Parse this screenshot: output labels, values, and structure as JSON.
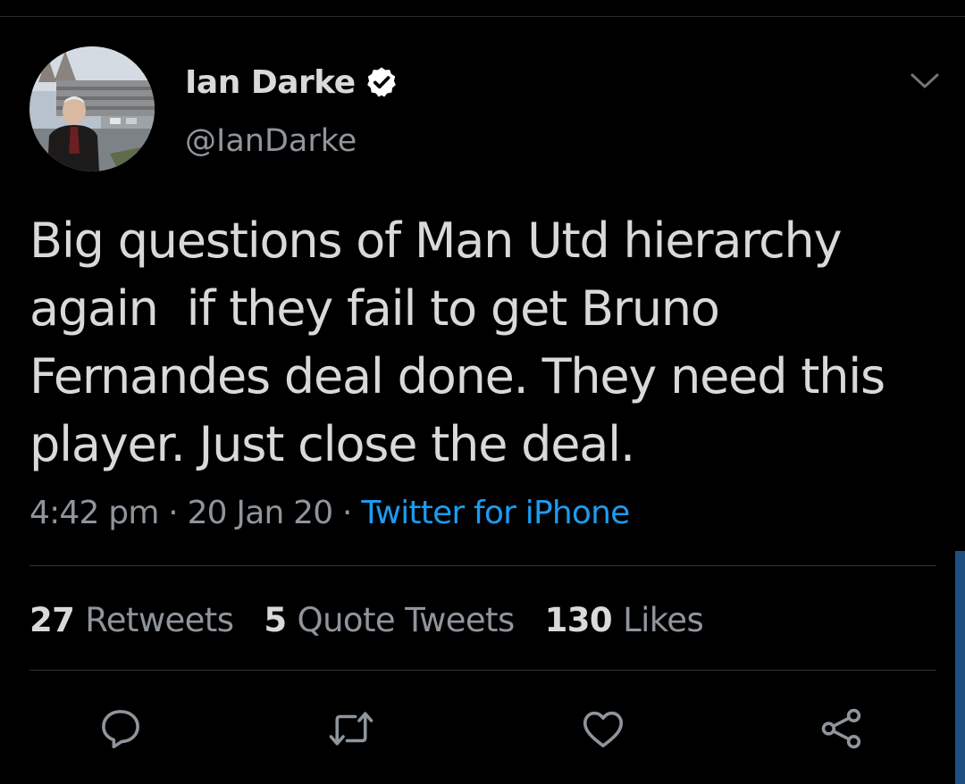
{
  "tweet": {
    "author": {
      "display_name": "Ian Darke",
      "handle": "@IanDarke",
      "verified": true,
      "avatar_icon": "profile-photo"
    },
    "text": "Big questions of Man Utd hierarchy\nagain  if they fail to get Bruno\nFernandes deal done. They need this\nplayer. Just close the deal.",
    "time": "4:42 pm",
    "date": "20 Jan 20",
    "separator": "·",
    "source": "Twitter for iPhone",
    "stats": {
      "retweets_count": "27",
      "retweets_label": "Retweets",
      "quote_count": "5",
      "quote_label": "Quote Tweets",
      "likes_count": "130",
      "likes_label": "Likes"
    },
    "actions": [
      "reply-icon",
      "retweet-icon",
      "like-icon",
      "share-icon"
    ]
  },
  "colors": {
    "background": "#000000",
    "primary_text": "#d9d9d9",
    "secondary_text": "#8f959b",
    "link": "#1d9bf0",
    "divider": "#2f3336"
  }
}
